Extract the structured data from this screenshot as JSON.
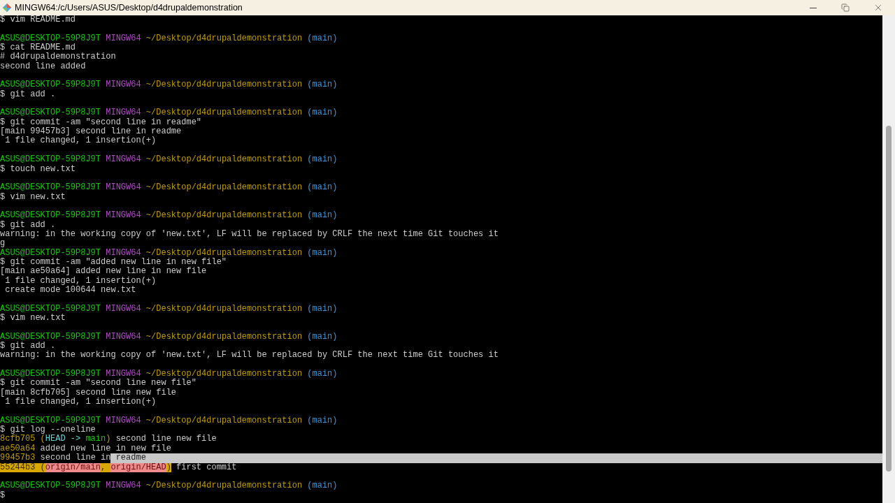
{
  "window": {
    "title": "MINGW64:/c/Users/ASUS/Desktop/d4drupaldemonstration"
  },
  "terminal": {
    "lines": [
      {
        "kind": "text",
        "segments": [
          {
            "kind": "plain",
            "text": "$ vim README.md"
          }
        ]
      },
      {
        "kind": "blank"
      },
      {
        "kind": "text",
        "segments": [
          {
            "kind": "user",
            "text": "ASUS@DESKTOP-59P8J9T"
          },
          {
            "kind": "system",
            "text": "MINGW64"
          },
          {
            "kind": "path",
            "text": "~/Desktop/d4drupaldemonstration"
          },
          {
            "kind": "branch",
            "text": "(main)"
          }
        ]
      },
      {
        "kind": "text",
        "segments": [
          {
            "kind": "plain",
            "text": "$ cat README.md"
          }
        ]
      },
      {
        "kind": "text",
        "segments": [
          {
            "kind": "plain",
            "text": "# d4drupaldemonstration"
          }
        ]
      },
      {
        "kind": "text",
        "segments": [
          {
            "kind": "plain",
            "text": "second line added"
          }
        ]
      },
      {
        "kind": "blank"
      },
      {
        "kind": "text",
        "segments": [
          {
            "kind": "user",
            "text": "ASUS@DESKTOP-59P8J9T"
          },
          {
            "kind": "system",
            "text": "MINGW64"
          },
          {
            "kind": "path",
            "text": "~/Desktop/d4drupaldemonstration"
          },
          {
            "kind": "branch",
            "text": "(main)"
          }
        ]
      },
      {
        "kind": "text",
        "segments": [
          {
            "kind": "plain",
            "text": "$ git add ."
          }
        ]
      },
      {
        "kind": "blank"
      },
      {
        "kind": "text",
        "segments": [
          {
            "kind": "user",
            "text": "ASUS@DESKTOP-59P8J9T"
          },
          {
            "kind": "system",
            "text": "MINGW64"
          },
          {
            "kind": "path",
            "text": "~/Desktop/d4drupaldemonstration"
          },
          {
            "kind": "branch",
            "text": "(main)"
          }
        ]
      },
      {
        "kind": "text",
        "segments": [
          {
            "kind": "plain",
            "text": "$ git commit -am \"second line in readme\""
          }
        ]
      },
      {
        "kind": "text",
        "segments": [
          {
            "kind": "plain",
            "text": "[main 99457b3] second line in readme"
          }
        ]
      },
      {
        "kind": "text",
        "segments": [
          {
            "kind": "plain",
            "text": " 1 file changed, 1 insertion(+)"
          }
        ]
      },
      {
        "kind": "blank"
      },
      {
        "kind": "text",
        "segments": [
          {
            "kind": "user",
            "text": "ASUS@DESKTOP-59P8J9T"
          },
          {
            "kind": "system",
            "text": "MINGW64"
          },
          {
            "kind": "path",
            "text": "~/Desktop/d4drupaldemonstration"
          },
          {
            "kind": "branch",
            "text": "(main)"
          }
        ]
      },
      {
        "kind": "text",
        "segments": [
          {
            "kind": "plain",
            "text": "$ touch new.txt"
          }
        ]
      },
      {
        "kind": "blank"
      },
      {
        "kind": "text",
        "segments": [
          {
            "kind": "user",
            "text": "ASUS@DESKTOP-59P8J9T"
          },
          {
            "kind": "system",
            "text": "MINGW64"
          },
          {
            "kind": "path",
            "text": "~/Desktop/d4drupaldemonstration"
          },
          {
            "kind": "branch",
            "text": "(main)"
          }
        ]
      },
      {
        "kind": "text",
        "segments": [
          {
            "kind": "plain",
            "text": "$ vim new.txt"
          }
        ]
      },
      {
        "kind": "blank"
      },
      {
        "kind": "text",
        "segments": [
          {
            "kind": "user",
            "text": "ASUS@DESKTOP-59P8J9T"
          },
          {
            "kind": "system",
            "text": "MINGW64"
          },
          {
            "kind": "path",
            "text": "~/Desktop/d4drupaldemonstration"
          },
          {
            "kind": "branch",
            "text": "(main)"
          }
        ]
      },
      {
        "kind": "text",
        "segments": [
          {
            "kind": "plain",
            "text": "$ git add ."
          }
        ]
      },
      {
        "kind": "text",
        "segments": [
          {
            "kind": "plain",
            "text": "warning: in the working copy of 'new.txt', LF will be replaced by CRLF the next time Git touches it"
          }
        ]
      },
      {
        "kind": "text",
        "segments": [
          {
            "kind": "plain",
            "text": "g"
          }
        ]
      },
      {
        "kind": "text",
        "segments": [
          {
            "kind": "user",
            "text": "ASUS@DESKTOP-59P8J9T"
          },
          {
            "kind": "system",
            "text": "MINGW64"
          },
          {
            "kind": "path",
            "text": "~/Desktop/d4drupaldemonstration"
          },
          {
            "kind": "branch",
            "text": "(main)"
          }
        ]
      },
      {
        "kind": "text",
        "segments": [
          {
            "kind": "plain",
            "text": "$ git commit -am \"added new line in new file\""
          }
        ]
      },
      {
        "kind": "text",
        "segments": [
          {
            "kind": "plain",
            "text": "[main ae50a64] added new line in new file"
          }
        ]
      },
      {
        "kind": "text",
        "segments": [
          {
            "kind": "plain",
            "text": " 1 file changed, 1 insertion(+)"
          }
        ]
      },
      {
        "kind": "text",
        "segments": [
          {
            "kind": "plain",
            "text": " create mode 100644 new.txt"
          }
        ]
      },
      {
        "kind": "blank"
      },
      {
        "kind": "text",
        "segments": [
          {
            "kind": "user",
            "text": "ASUS@DESKTOP-59P8J9T"
          },
          {
            "kind": "system",
            "text": "MINGW64"
          },
          {
            "kind": "path",
            "text": "~/Desktop/d4drupaldemonstration"
          },
          {
            "kind": "branch",
            "text": "(main)"
          }
        ]
      },
      {
        "kind": "text",
        "segments": [
          {
            "kind": "plain",
            "text": "$ vim new.txt"
          }
        ]
      },
      {
        "kind": "blank"
      },
      {
        "kind": "text",
        "segments": [
          {
            "kind": "user",
            "text": "ASUS@DESKTOP-59P8J9T"
          },
          {
            "kind": "system",
            "text": "MINGW64"
          },
          {
            "kind": "path",
            "text": "~/Desktop/d4drupaldemonstration"
          },
          {
            "kind": "branch",
            "text": "(main)"
          }
        ]
      },
      {
        "kind": "text",
        "segments": [
          {
            "kind": "plain",
            "text": "$ git add ."
          }
        ]
      },
      {
        "kind": "text",
        "segments": [
          {
            "kind": "plain",
            "text": "warning: in the working copy of 'new.txt', LF will be replaced by CRLF the next time Git touches it"
          }
        ]
      },
      {
        "kind": "blank"
      },
      {
        "kind": "text",
        "segments": [
          {
            "kind": "user",
            "text": "ASUS@DESKTOP-59P8J9T"
          },
          {
            "kind": "system",
            "text": "MINGW64"
          },
          {
            "kind": "path",
            "text": "~/Desktop/d4drupaldemonstration"
          },
          {
            "kind": "branch",
            "text": "(main)"
          }
        ]
      },
      {
        "kind": "text",
        "segments": [
          {
            "kind": "plain",
            "text": "$ git commit -am \"second line new file\""
          }
        ]
      },
      {
        "kind": "text",
        "segments": [
          {
            "kind": "plain",
            "text": "[main 8cfb705] second line new file"
          }
        ]
      },
      {
        "kind": "text",
        "segments": [
          {
            "kind": "plain",
            "text": " 1 file changed, 1 insertion(+)"
          }
        ]
      },
      {
        "kind": "blank"
      },
      {
        "kind": "text",
        "segments": [
          {
            "kind": "user",
            "text": "ASUS@DESKTOP-59P8J9T"
          },
          {
            "kind": "system",
            "text": "MINGW64"
          },
          {
            "kind": "path",
            "text": "~/Desktop/d4drupaldemonstration"
          },
          {
            "kind": "branch",
            "text": "(main)"
          }
        ]
      },
      {
        "kind": "text",
        "segments": [
          {
            "kind": "plain",
            "text": "$ git log --oneline"
          }
        ]
      },
      {
        "kind": "text",
        "segments": [
          {
            "kind": "hash",
            "text": "8cfb705 "
          },
          {
            "kind": "hash",
            "text": "("
          },
          {
            "kind": "head",
            "text": "HEAD -> "
          },
          {
            "kind": "local",
            "text": "main"
          },
          {
            "kind": "hash",
            "text": ")"
          },
          {
            "kind": "plain",
            "text": " second line new file"
          }
        ]
      },
      {
        "kind": "text",
        "segments": [
          {
            "kind": "hash",
            "text": "ae50a64"
          },
          {
            "kind": "plain",
            "text": " added new line in new file"
          }
        ]
      },
      {
        "kind": "text",
        "segments": [
          {
            "kind": "hash",
            "text": "99457b3"
          },
          {
            "kind": "plain",
            "text": " second line in"
          },
          {
            "kind": "selected",
            "text": " readme"
          }
        ]
      },
      {
        "kind": "text",
        "segments": [
          {
            "kind": "hash_marked",
            "text": "55244b3 ("
          },
          {
            "kind": "remote_marked",
            "text": "origin/main"
          },
          {
            "kind": "hash_marked",
            "text": ", "
          },
          {
            "kind": "remote_marked",
            "text": "origin/HEAD"
          },
          {
            "kind": "hash_marked",
            "text": ")"
          },
          {
            "kind": "plain",
            "text": " first commit"
          }
        ]
      },
      {
        "kind": "blank"
      },
      {
        "kind": "text",
        "segments": [
          {
            "kind": "user",
            "text": "ASUS@DESKTOP-59P8J9T"
          },
          {
            "kind": "system",
            "text": "MINGW64"
          },
          {
            "kind": "path",
            "text": "~/Desktop/d4drupaldemonstration"
          },
          {
            "kind": "branch",
            "text": "(main)"
          }
        ]
      },
      {
        "kind": "text",
        "segments": [
          {
            "kind": "plain",
            "text": "$"
          }
        ]
      }
    ]
  }
}
